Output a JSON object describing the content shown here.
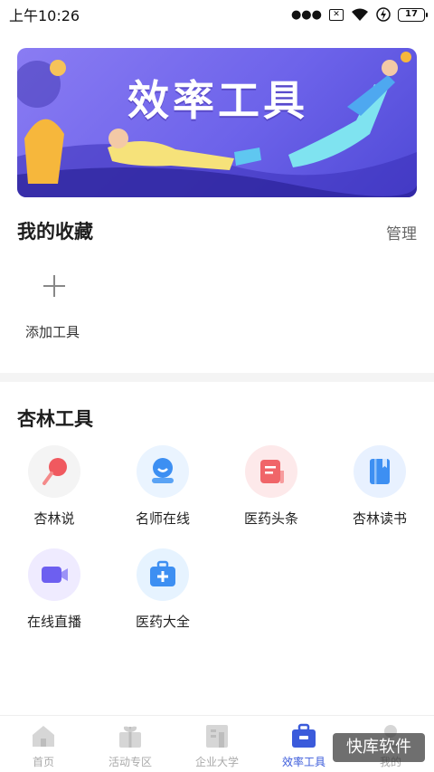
{
  "status_bar": {
    "time": "上午10:26",
    "icons": [
      "dots-icon",
      "sim-off-icon",
      "wifi-icon",
      "charging-icon",
      "battery-icon"
    ],
    "battery": "17"
  },
  "banner": {
    "title": "效率工具",
    "bg_color": "#6d63ea"
  },
  "favorites": {
    "title": "我的收藏",
    "manage": "管理",
    "add_label": "添加工具"
  },
  "tools": {
    "title": "杏林工具",
    "items": [
      {
        "label": "杏林说",
        "icon": "microphone-icon",
        "color": "#f4f4f4"
      },
      {
        "label": "名师在线",
        "icon": "teacher-icon",
        "color": "#eaf4ff"
      },
      {
        "label": "医药头条",
        "icon": "news-icon",
        "color": "#fde9ea"
      },
      {
        "label": "杏林读书",
        "icon": "book-icon",
        "color": "#e8f1ff"
      },
      {
        "label": "在线直播",
        "icon": "video-icon",
        "color": "#efebff"
      },
      {
        "label": "医药大全",
        "icon": "medkit-icon",
        "color": "#e6f3ff"
      }
    ]
  },
  "bottom_nav": {
    "items": [
      {
        "label": "首页",
        "icon": "home-icon"
      },
      {
        "label": "活动专区",
        "icon": "gift-icon"
      },
      {
        "label": "企业大学",
        "icon": "building-icon"
      },
      {
        "label": "效率工具",
        "icon": "toolbox-icon",
        "active": true
      },
      {
        "label": "我的",
        "icon": "profile-icon"
      }
    ],
    "active_color": "#3b5bdb"
  },
  "watermark": "快库软件"
}
